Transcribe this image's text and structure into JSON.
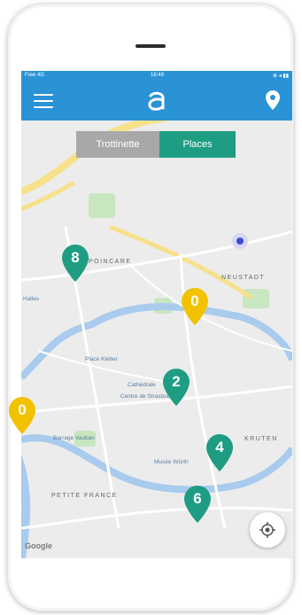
{
  "status_bar": {
    "carrier": "Free 4G",
    "time": "16:49",
    "right": "⊕ ◂ ▮▮ "
  },
  "app_bar": {
    "menu_icon": "hamburger-icon",
    "logo_icon": "app-logo-icon",
    "location_icon": "map-pin-icon"
  },
  "toggle": {
    "left_label": "Trottinette",
    "right_label": "Places"
  },
  "markers": [
    {
      "label": "8",
      "color": "#1f9d83"
    },
    {
      "label": "0",
      "color": "#f2c200"
    },
    {
      "label": "2",
      "color": "#1f9d83"
    },
    {
      "label": "0",
      "color": "#f2c200"
    },
    {
      "label": "4",
      "color": "#1f9d83"
    },
    {
      "label": "6",
      "color": "#1f9d83"
    }
  ],
  "map_labels": {
    "district_1": "POINCARE",
    "district_2": "NEUSTADT",
    "district_3": "KRUTEN",
    "district_4": "PETITE FRANCE",
    "poi_1": "Halles",
    "poi_2": "Place Kléber",
    "poi_3": "Cathédrale",
    "poi_4": "Centre de Strasbourg",
    "poi_5": "Barrage Vauban",
    "poi_6": "Musée Würth"
  },
  "attribution": "Google",
  "colors": {
    "primary": "#2a93d6",
    "accent": "#1f9d83",
    "warning": "#f2c200"
  },
  "locate_icon": "crosshair-icon"
}
